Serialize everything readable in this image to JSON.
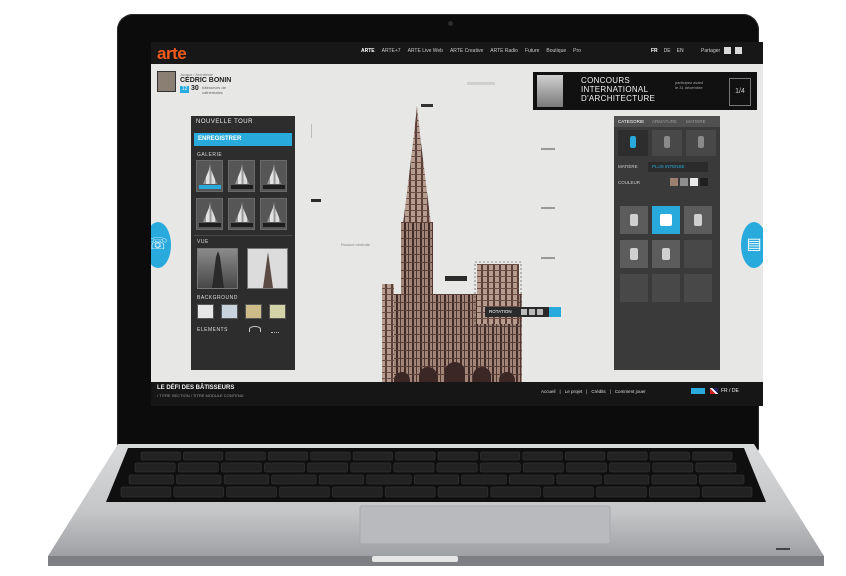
{
  "brand": {
    "logo": "arte",
    "accent": "#29aadd",
    "logo_color": "#f25a1c"
  },
  "topnav": {
    "items": [
      "ARTE",
      "ARTE+7",
      "ARTE Live Web",
      "ARTE Creative",
      "ARTE Radio",
      "Future",
      "Boutique",
      "Pro"
    ],
    "active_index": 0,
    "languages": [
      "FR",
      "DE",
      "EN"
    ],
    "active_language": "FR",
    "tools_label": "Partager"
  },
  "user": {
    "small_label": "Joueur / Architecte",
    "name": "CÉDRIC BONIN",
    "level_badge": "12",
    "score": "30",
    "score_note": "bâtisseurs de cathédrales"
  },
  "ad": {
    "title_line1": "CONCOURS",
    "title_line2": "INTERNATIONAL",
    "title_line3": "D'ARCHITECTURE",
    "sub": "participez avant le 31 décembre",
    "logo_text": "1/4"
  },
  "left_panel": {
    "title": "NOUVELLE TOUR",
    "primary_button": "ENREGISTRER",
    "gallery_label": "GALERIE",
    "view_label": "VUE",
    "background_label": "BACKGROUND",
    "elements_label": "ELEMENTS"
  },
  "right_panel": {
    "tabs": [
      "CATEGORIE",
      "ARMATURE",
      "MATIERE"
    ],
    "active_tab": 0,
    "material_label": "MATIÈRE",
    "material_value": "PLUS INTENSE",
    "color_label": "COULEUR"
  },
  "canvas": {
    "annotation": "Rosace centrale",
    "element_toolbar_label": "ROTATION"
  },
  "side_buttons": {
    "left_icon": "phone-icon",
    "right_icon": "save-icon"
  },
  "footer": {
    "title": "LE DÉFI DES BÂTISSEURS",
    "subtitle": "/ TITRE SECTION / TITRE MODULE CONTENU",
    "links": [
      "Accueil",
      "Le projet",
      "Crédits",
      "Comment jouer"
    ],
    "lang": "FR / DE"
  }
}
